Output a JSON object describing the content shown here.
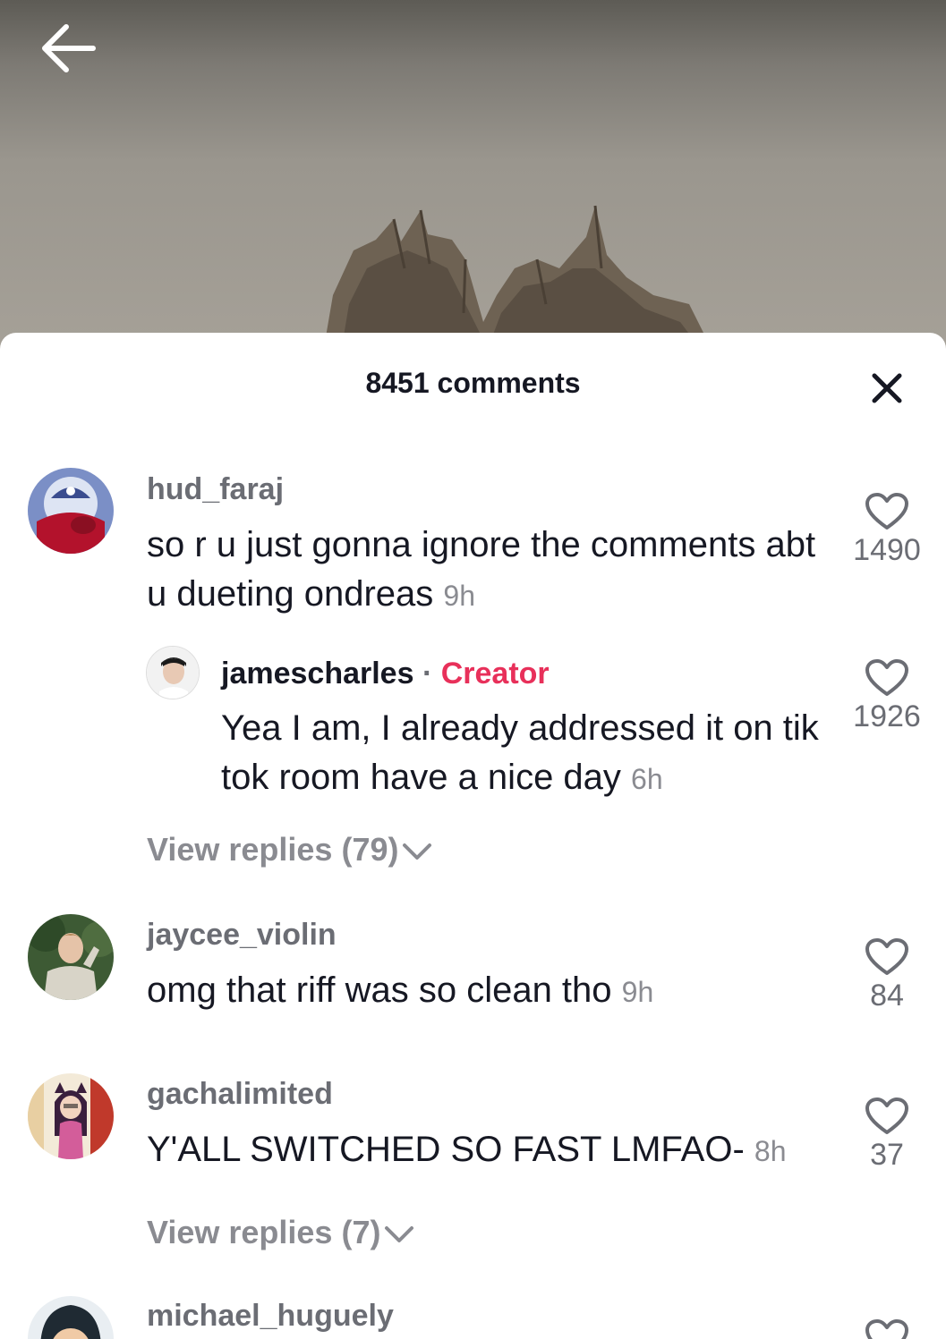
{
  "header": {
    "back_icon": "arrow-left-icon",
    "comment_count_label": "8451 comments",
    "close_icon": "close-x-icon"
  },
  "comments": [
    {
      "username": "hud_faraj",
      "text": "so r u just gonna ignore the comments abt u dueting ondreas",
      "time": "9h",
      "likes": "1490",
      "reply": {
        "username": "jamescharles",
        "separator": "·",
        "badge": "Creator",
        "text": "Yea I am, I already addressed it on tik tok room have a nice day",
        "time": "6h",
        "likes": "1926"
      },
      "view_replies": "View replies (79)"
    },
    {
      "username": "jaycee_violin",
      "text": "omg that riff was so clean tho",
      "time": "9h",
      "likes": "84"
    },
    {
      "username": "gachalimited",
      "text": "Y'ALL SWITCHED SO FAST LMFAO-",
      "time": "8h",
      "likes": "37",
      "view_replies": "View replies (7)"
    },
    {
      "username": "michael_huguely"
    }
  ],
  "colors": {
    "creator_badge": "#e8305a",
    "text_primary": "#161823",
    "text_secondary": "#8a8b91"
  }
}
